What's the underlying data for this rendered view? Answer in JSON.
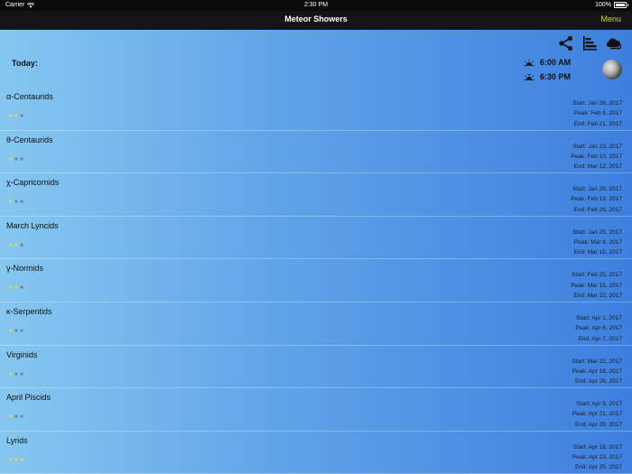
{
  "status_bar": {
    "carrier": "Carrier",
    "time": "2:30 PM",
    "battery": "100%"
  },
  "nav": {
    "title": "Meteor Showers",
    "menu_label": "Menu"
  },
  "toolbar_icons": [
    "share-icon",
    "list-icon",
    "cloud-icon"
  ],
  "today": {
    "label": "Today:",
    "sunrise": "6:00 AM",
    "sunset": "6:30 PM"
  },
  "colors": {
    "menu_accent": "#c7e01b",
    "star_on": "#e7df2c",
    "star_off": "#6c6f8a"
  },
  "showers": [
    {
      "name": "α-Centaurids",
      "rating": 2,
      "start": "Start: Jan 28, 2017",
      "peak": "Peak: Feb 8, 2017",
      "end": "End: Feb 21, 2017"
    },
    {
      "name": "θ-Centaurids",
      "rating": 1,
      "start": "Start: Jan 23, 2017",
      "peak": "Peak: Feb 10, 2017",
      "end": "End: Mar 12, 2017"
    },
    {
      "name": "χ-Capricornids",
      "rating": 1,
      "start": "Start: Jan 29, 2017",
      "peak": "Peak: Feb 13, 2017",
      "end": "End: Feb 28, 2017"
    },
    {
      "name": "March Lyncids",
      "rating": 2,
      "start": "Start: Jan 25, 2017",
      "peak": "Peak: Mar 8, 2017",
      "end": "End: Mar 15, 2017"
    },
    {
      "name": "γ-Normids",
      "rating": 2,
      "start": "Start: Feb 25, 2017",
      "peak": "Peak: Mar 15, 2017",
      "end": "End: Mar 22, 2017"
    },
    {
      "name": "κ-Serpentids",
      "rating": 1,
      "start": "Start: Apr 1, 2017",
      "peak": "Peak: Apr 6, 2017",
      "end": "End: Apr 7, 2017"
    },
    {
      "name": "Virginids",
      "rating": 1,
      "start": "Start: Mar 22, 2017",
      "peak": "Peak: Apr 18, 2017",
      "end": "End: Apr 26, 2017"
    },
    {
      "name": "April Piscids",
      "rating": 1,
      "start": "Start: Apr 8, 2017",
      "peak": "Peak: Apr 21, 2017",
      "end": "End: Apr 29, 2017"
    },
    {
      "name": "Lyrids",
      "rating": 3,
      "start": "Start: Apr 16, 2017",
      "peak": "Peak: Apr 23, 2017",
      "end": "End: Apr 25, 2017"
    }
  ]
}
